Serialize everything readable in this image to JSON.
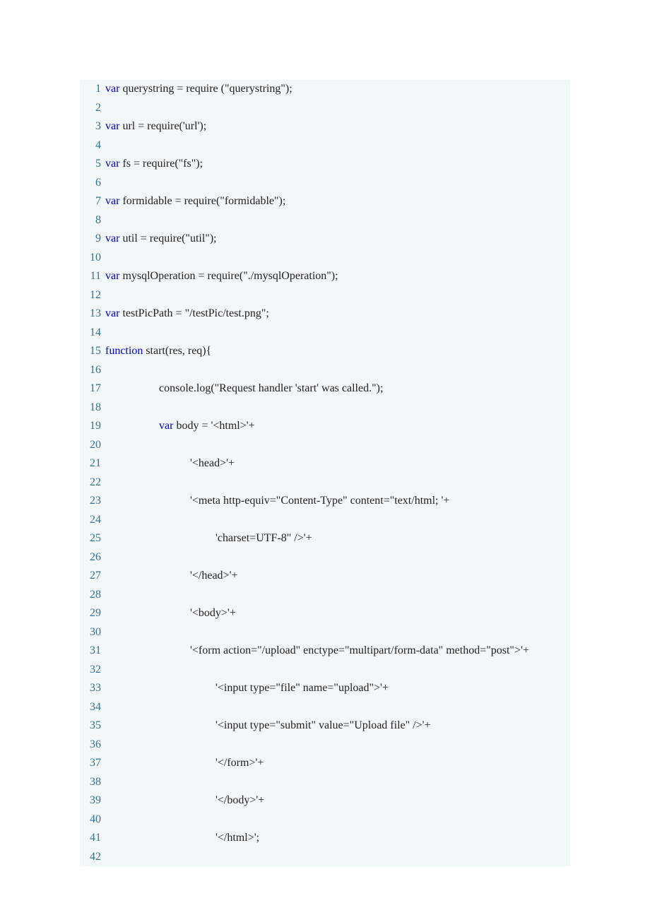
{
  "lines": [
    {
      "n": 1,
      "segs": [
        {
          "t": "var",
          "c": "kw"
        },
        {
          "t": " querystring = require (\"querystring\");",
          "c": "plain"
        }
      ]
    },
    {
      "n": 2,
      "segs": []
    },
    {
      "n": 3,
      "segs": [
        {
          "t": "var",
          "c": "kw"
        },
        {
          "t": " url = require('url');",
          "c": "plain"
        }
      ]
    },
    {
      "n": 4,
      "segs": []
    },
    {
      "n": 5,
      "segs": [
        {
          "t": "var",
          "c": "kw"
        },
        {
          "t": " fs = require(\"fs\");",
          "c": "plain"
        }
      ]
    },
    {
      "n": 6,
      "segs": []
    },
    {
      "n": 7,
      "segs": [
        {
          "t": "var",
          "c": "kw"
        },
        {
          "t": " formidable = require(\"formidable\");",
          "c": "plain"
        }
      ]
    },
    {
      "n": 8,
      "segs": []
    },
    {
      "n": 9,
      "segs": [
        {
          "t": "var",
          "c": "kw"
        },
        {
          "t": " util = require(\"util\");",
          "c": "plain"
        }
      ]
    },
    {
      "n": 10,
      "segs": []
    },
    {
      "n": 11,
      "segs": [
        {
          "t": "var",
          "c": "kw"
        },
        {
          "t": " mysqlOperation = require(\"./mysqlOperation\");",
          "c": "plain"
        }
      ]
    },
    {
      "n": 12,
      "segs": []
    },
    {
      "n": 13,
      "segs": [
        {
          "t": "var",
          "c": "kw"
        },
        {
          "t": " testPicPath = \"/testPic/test.png\";",
          "c": "plain"
        }
      ]
    },
    {
      "n": 14,
      "segs": []
    },
    {
      "n": 15,
      "segs": [
        {
          "t": "function",
          "c": "kw"
        },
        {
          "t": " start(res, req){",
          "c": "plain"
        }
      ]
    },
    {
      "n": 16,
      "segs": []
    },
    {
      "n": 17,
      "segs": [
        {
          "t": "                   console.log(\"Request handler 'start' was called.\");",
          "c": "plain"
        }
      ]
    },
    {
      "n": 18,
      "segs": []
    },
    {
      "n": 19,
      "segs": [
        {
          "t": "                   ",
          "c": "plain"
        },
        {
          "t": "var",
          "c": "kw"
        },
        {
          "t": " body = '<html>'+",
          "c": "plain"
        }
      ]
    },
    {
      "n": 20,
      "segs": []
    },
    {
      "n": 21,
      "segs": [
        {
          "t": "                              '<head>'+",
          "c": "plain"
        }
      ]
    },
    {
      "n": 22,
      "segs": []
    },
    {
      "n": 23,
      "segs": [
        {
          "t": "                              '<meta http-equiv=\"Content-Type\" content=\"text/html; '+",
          "c": "plain"
        }
      ]
    },
    {
      "n": 24,
      "segs": []
    },
    {
      "n": 25,
      "segs": [
        {
          "t": "                                       'charset=UTF-8\" />'+",
          "c": "plain"
        }
      ]
    },
    {
      "n": 26,
      "segs": []
    },
    {
      "n": 27,
      "segs": [
        {
          "t": "                              '</head>'+",
          "c": "plain"
        }
      ]
    },
    {
      "n": 28,
      "segs": []
    },
    {
      "n": 29,
      "segs": [
        {
          "t": "                              '<body>'+",
          "c": "plain"
        }
      ]
    },
    {
      "n": 30,
      "segs": []
    },
    {
      "n": 31,
      "segs": [
        {
          "t": "                              '<form action=\"/upload\" enctype=\"multipart/form-data\" method=\"post\">'+",
          "c": "plain"
        }
      ]
    },
    {
      "n": 32,
      "segs": []
    },
    {
      "n": 33,
      "segs": [
        {
          "t": "                                       '<input type=\"file\" name=\"upload\">'+",
          "c": "plain"
        }
      ]
    },
    {
      "n": 34,
      "segs": []
    },
    {
      "n": 35,
      "segs": [
        {
          "t": "                                       '<input type=\"submit\" value=\"Upload file\" />'+",
          "c": "plain"
        }
      ]
    },
    {
      "n": 36,
      "segs": []
    },
    {
      "n": 37,
      "segs": [
        {
          "t": "                                       '</form>'+",
          "c": "plain"
        }
      ]
    },
    {
      "n": 38,
      "segs": []
    },
    {
      "n": 39,
      "segs": [
        {
          "t": "                                       '</body>'+",
          "c": "plain"
        }
      ]
    },
    {
      "n": 40,
      "segs": []
    },
    {
      "n": 41,
      "segs": [
        {
          "t": "                                       '</html>';",
          "c": "plain"
        }
      ]
    },
    {
      "n": 42,
      "segs": []
    }
  ]
}
